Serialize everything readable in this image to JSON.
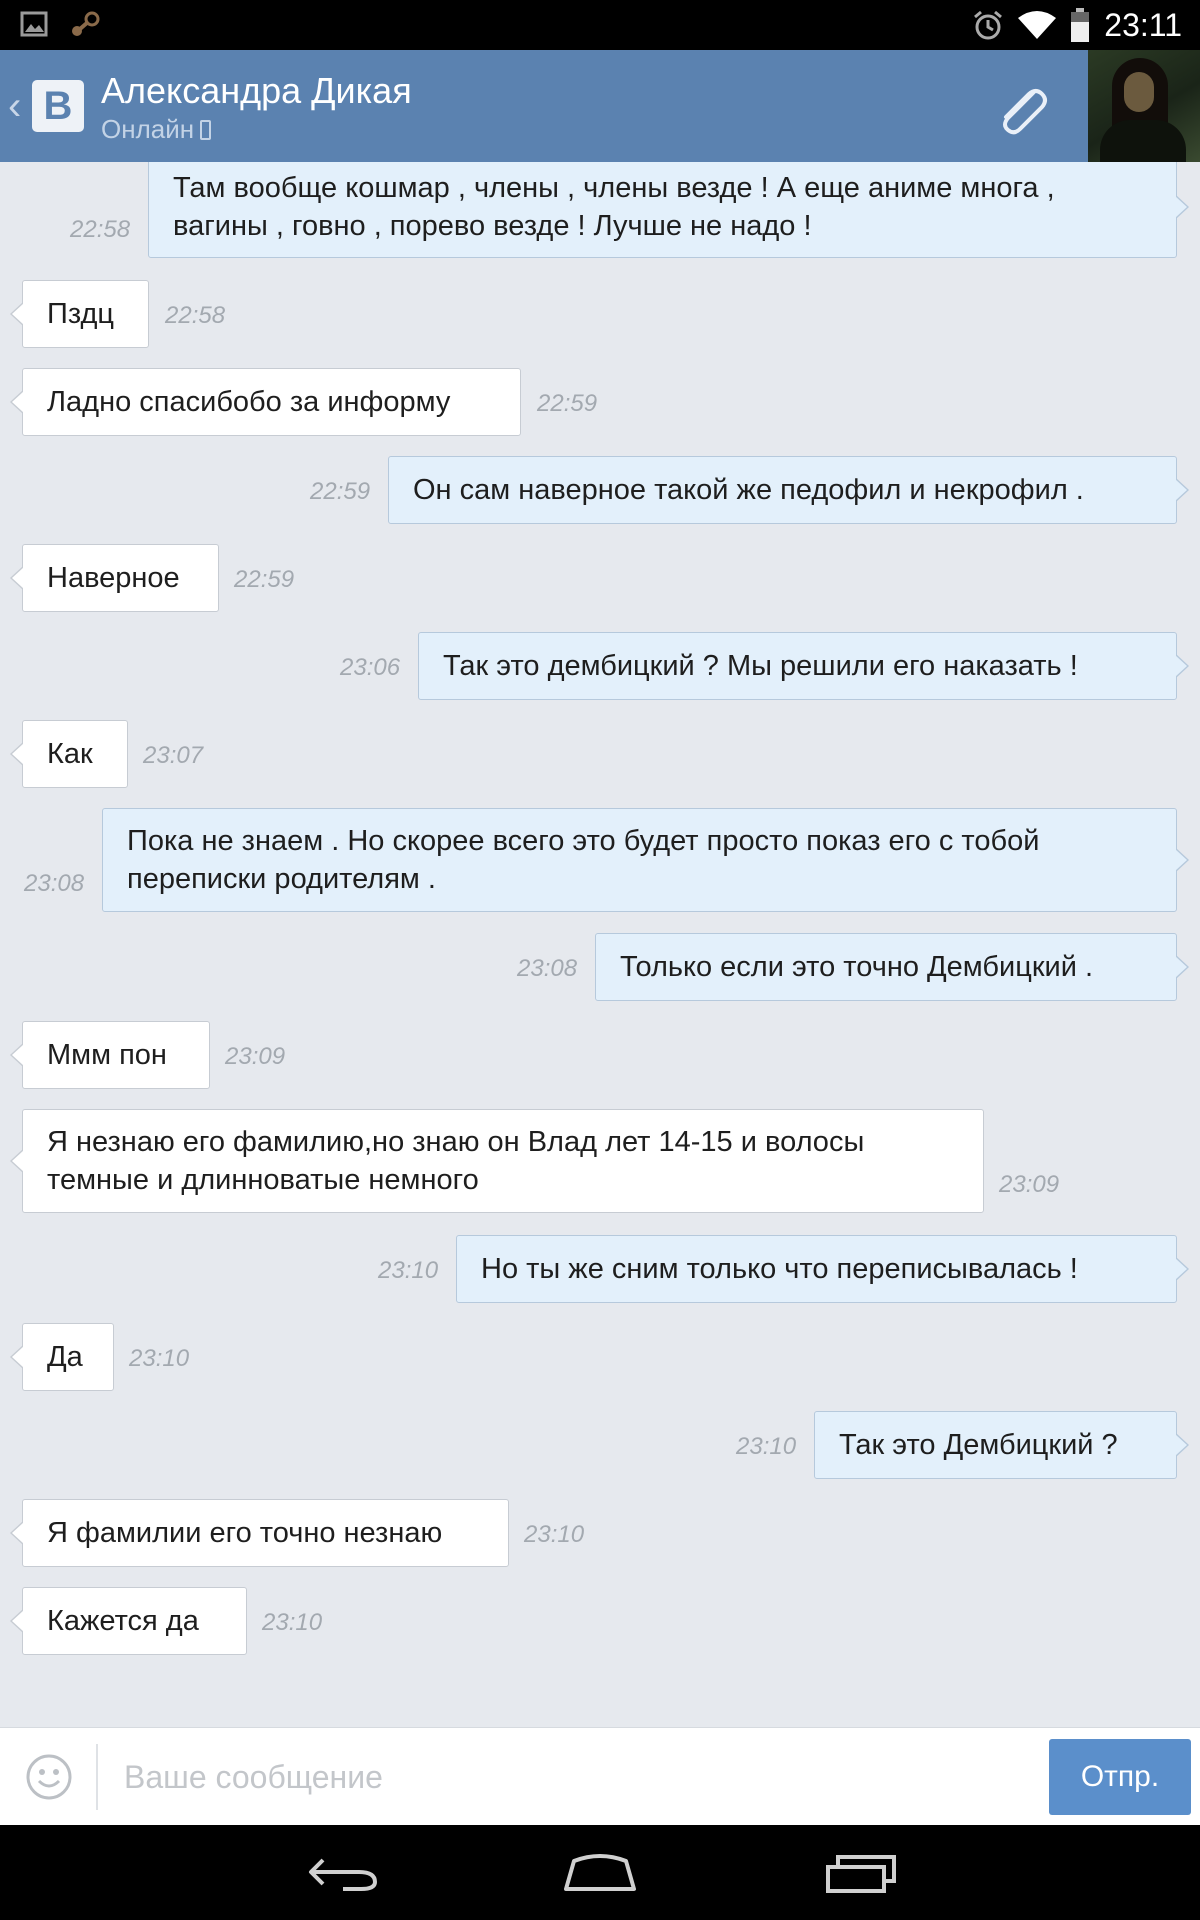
{
  "status_bar": {
    "time": "23:11",
    "left_icons": [
      "image-icon",
      "steam-icon"
    ],
    "right_icons": [
      "alarm-icon",
      "wifi-icon",
      "battery-icon"
    ]
  },
  "header": {
    "contact_name": "Александра Дикая",
    "status": "Онлайн",
    "logo_letter": "B",
    "back_glyph": "‹",
    "accent_color": "#5b82b0"
  },
  "messages": [
    {
      "dir": "out",
      "lines": [
        "Там вообще кошмар , члены , члены везде ! А еще аниме многа ,",
        "вагины , говно , порево везде ! Лучше не надо !"
      ],
      "time": "22:58"
    },
    {
      "dir": "in",
      "lines": [
        "Пздц"
      ],
      "time": "22:58"
    },
    {
      "dir": "in",
      "lines": [
        "Ладно спасибобо за информу"
      ],
      "time": "22:59"
    },
    {
      "dir": "out",
      "lines": [
        "Он сам наверное такой же педофил и некрофил ."
      ],
      "time": "22:59"
    },
    {
      "dir": "in",
      "lines": [
        "Наверное"
      ],
      "time": "22:59"
    },
    {
      "dir": "out",
      "lines": [
        "Так это дембицкий ? Мы решили его наказать !"
      ],
      "time": "23:06"
    },
    {
      "dir": "in",
      "lines": [
        "Как"
      ],
      "time": "23:07"
    },
    {
      "dir": "out",
      "lines": [
        "Пока не знаем . Но скорее всего это будет просто показ его с тобой",
        "переписки родителям ."
      ],
      "time": "23:08"
    },
    {
      "dir": "out",
      "lines": [
        "Только если это точно Дембицкий ."
      ],
      "time": "23:08"
    },
    {
      "dir": "in",
      "lines": [
        "Ммм пон"
      ],
      "time": "23:09"
    },
    {
      "dir": "in",
      "lines": [
        "Я незнаю его фамилию,но знаю он Влад лет 14-15 и волосы",
        "темные и длинноватые немного"
      ],
      "time": "23:09"
    },
    {
      "dir": "out",
      "lines": [
        "Но ты же сним только что переписывалась !"
      ],
      "time": "23:10"
    },
    {
      "dir": "in",
      "lines": [
        "Да"
      ],
      "time": "23:10"
    },
    {
      "dir": "out",
      "lines": [
        "Так это Дембицкий ?"
      ],
      "time": "23:10"
    },
    {
      "dir": "in",
      "lines": [
        "Я фамилии его точно незнаю"
      ],
      "time": "23:10"
    },
    {
      "dir": "in",
      "lines": [
        "Кажется да"
      ],
      "time": "23:10"
    }
  ],
  "composer": {
    "placeholder": "Ваше сообщение",
    "value": "",
    "send_label": "Отпр."
  },
  "nav_bar": {
    "buttons": [
      "back-icon",
      "home-icon",
      "recent-apps-icon"
    ]
  }
}
